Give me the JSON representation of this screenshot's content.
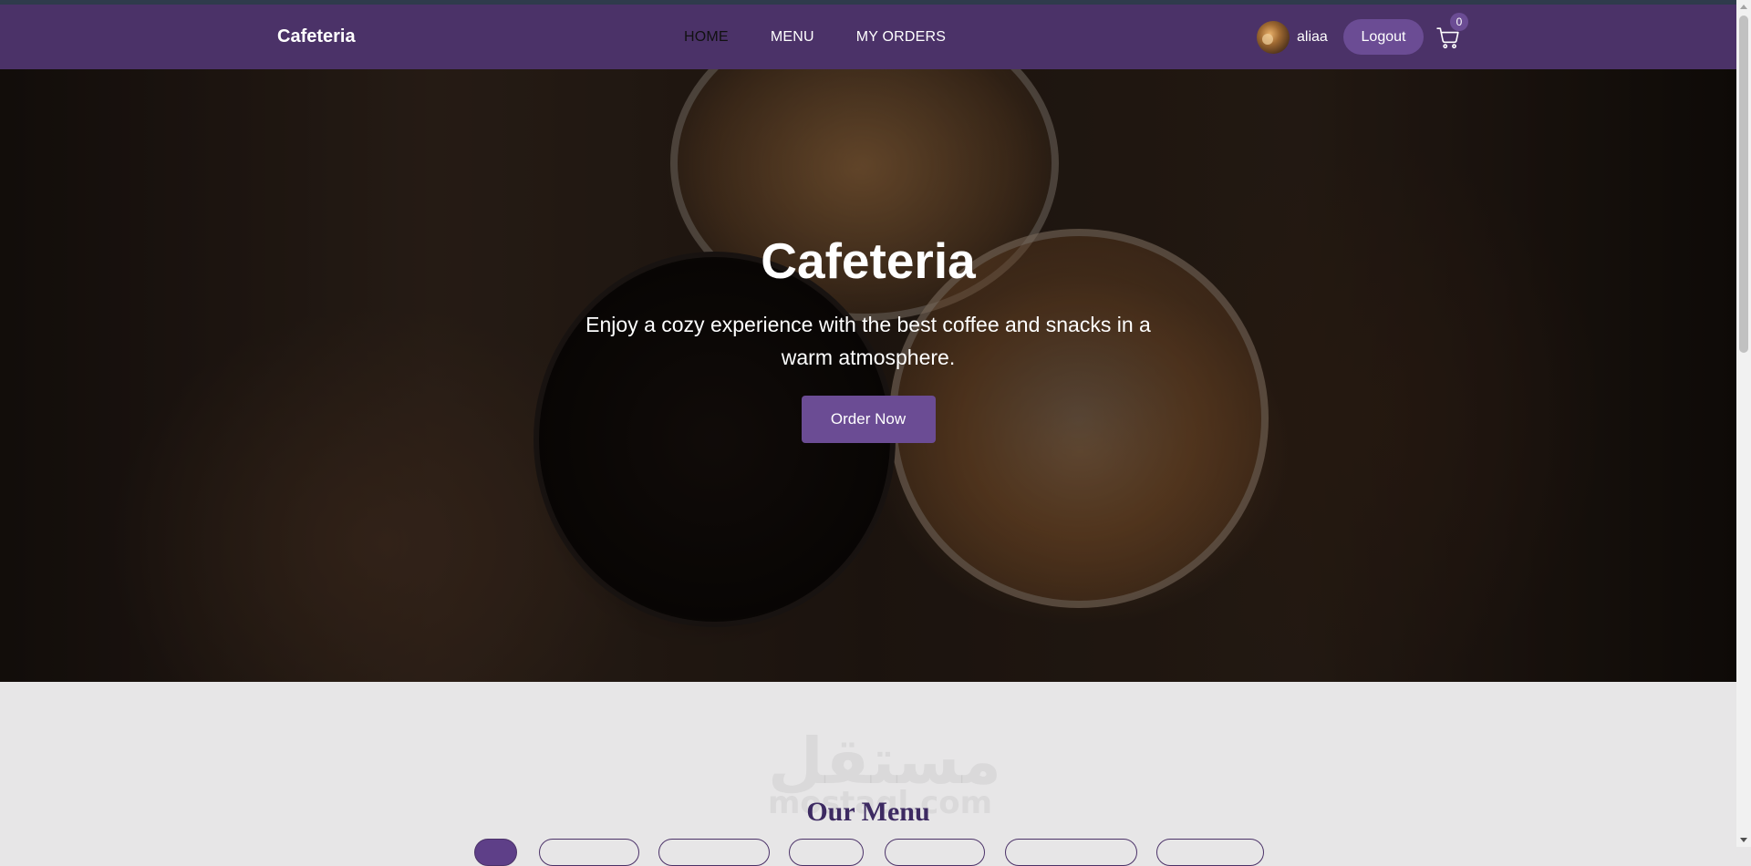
{
  "navbar": {
    "brand": "Cafeteria",
    "links": [
      {
        "label": "HOME",
        "active": true
      },
      {
        "label": "MENU",
        "active": false
      },
      {
        "label": "MY ORDERS",
        "active": false
      }
    ],
    "username": "aliaa",
    "logout_label": "Logout",
    "cart_count": "0"
  },
  "hero": {
    "title": "Cafeteria",
    "text": "Enjoy a cozy experience with the best coffee and snacks in a warm atmosphere.",
    "cta_label": "Order Now"
  },
  "menu_section": {
    "title": "Our Menu",
    "tab_count_visible": 7
  },
  "watermark": {
    "arabic": "مستقل",
    "latin": "mostaql.com"
  },
  "colors": {
    "navbar": "#4b3268",
    "accent": "#6b4c94",
    "menu_title": "#3d2a62",
    "section_bg": "#e7e6e7"
  },
  "icons": {
    "cart": "cart-icon",
    "avatar": "avatar"
  }
}
